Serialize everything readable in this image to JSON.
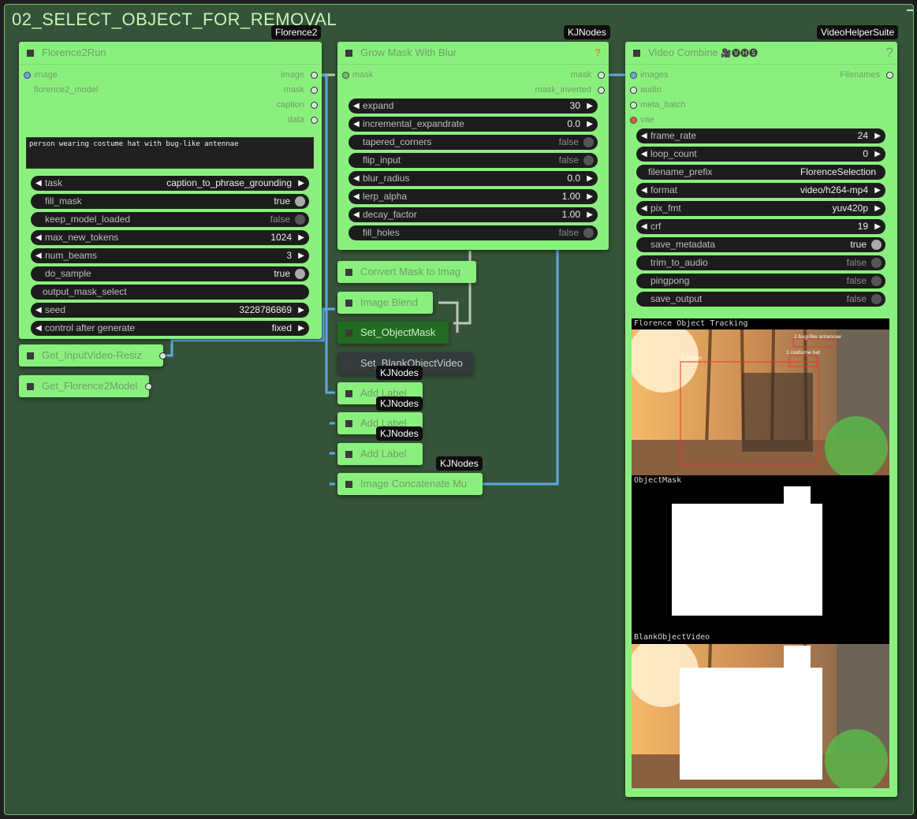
{
  "group": {
    "title": "02_SELECT_OBJECT_FOR_REMOVAL"
  },
  "florence": {
    "badge": "Florence2",
    "title": "Florence2Run",
    "inputs": [
      "image",
      "florence2_model"
    ],
    "outputs": [
      "image",
      "mask",
      "caption",
      "data"
    ],
    "prompt": "person wearing costume hat with bug-like antennae",
    "widgets": [
      {
        "label": "task",
        "value": "caption_to_phrase_grounding",
        "kind": "combo"
      },
      {
        "label": "fill_mask",
        "value": "true",
        "kind": "toggle-on"
      },
      {
        "label": "keep_model_loaded",
        "value": "false",
        "kind": "toggle-off"
      },
      {
        "label": "max_new_tokens",
        "value": "1024",
        "kind": "combo"
      },
      {
        "label": "num_beams",
        "value": "3",
        "kind": "combo"
      },
      {
        "label": "do_sample",
        "value": "true",
        "kind": "toggle-on"
      },
      {
        "label": "output_mask_select",
        "value": "",
        "kind": "text"
      },
      {
        "label": "seed",
        "value": "3228786869",
        "kind": "combo"
      },
      {
        "label": "control after generate",
        "value": "fixed",
        "kind": "combo"
      }
    ]
  },
  "get_input_video": {
    "title": "Get_InputVideo-Resiz"
  },
  "get_florence_model": {
    "title": "Get_Florence2Model"
  },
  "grow_mask": {
    "badge": "KJNodes",
    "title": "Grow Mask With Blur",
    "help": "?",
    "input": "mask",
    "outputs": [
      "mask",
      "mask_inverted"
    ],
    "widgets": [
      {
        "label": "expand",
        "value": "30",
        "kind": "combo"
      },
      {
        "label": "incremental_expandrate",
        "value": "0.0",
        "kind": "combo"
      },
      {
        "label": "tapered_corners",
        "value": "false",
        "kind": "toggle-off"
      },
      {
        "label": "flip_input",
        "value": "false",
        "kind": "toggle-off"
      },
      {
        "label": "blur_radius",
        "value": "0.0",
        "kind": "combo"
      },
      {
        "label": "lerp_alpha",
        "value": "1.00",
        "kind": "combo"
      },
      {
        "label": "decay_factor",
        "value": "1.00",
        "kind": "combo"
      },
      {
        "label": "fill_holes",
        "value": "false",
        "kind": "toggle-off"
      }
    ]
  },
  "mid_nodes": {
    "convert": "Convert Mask to Imag",
    "blend": "Image Blend",
    "set_mask": "Set_ObjectMask",
    "set_blank": "Set_BlankObjectVideo",
    "label1": "Add Label",
    "label2": "Add Label",
    "label3": "Add Label",
    "concat": "Image Concatenate Mu",
    "kj_badges": [
      "KJNodes",
      "KJNodes",
      "KJNodes",
      "KJNodes"
    ]
  },
  "video_combine": {
    "badge": "VideoHelperSuite",
    "title": "Video Combine",
    "title_icons": "🎥🅥🅗🅢",
    "help": "?",
    "inputs": [
      "images",
      "audio",
      "meta_batch",
      "vae"
    ],
    "output": "Filenames",
    "widgets": [
      {
        "label": "frame_rate",
        "value": "24",
        "kind": "combo"
      },
      {
        "label": "loop_count",
        "value": "0",
        "kind": "combo"
      },
      {
        "label": "filename_prefix",
        "value": "FlorenceSelection",
        "kind": "text"
      },
      {
        "label": "format",
        "value": "video/h264-mp4",
        "kind": "combo"
      },
      {
        "label": "pix_fmt",
        "value": "yuv420p",
        "kind": "combo"
      },
      {
        "label": "crf",
        "value": "19",
        "kind": "combo"
      },
      {
        "label": "save_metadata",
        "value": "true",
        "kind": "toggle-on"
      },
      {
        "label": "trim_to_audio",
        "value": "false",
        "kind": "toggle-off"
      },
      {
        "label": "pingpong",
        "value": "false",
        "kind": "toggle-off"
      },
      {
        "label": "save_output",
        "value": "false",
        "kind": "toggle-off"
      }
    ],
    "preview_labels": [
      "Florence Object Tracking",
      "ObjectMask",
      "BlankObjectVideo"
    ],
    "bbox_labels": [
      "0.person",
      "1.costume hat",
      "2.bug-like antennae"
    ]
  },
  "colors": {
    "node": "#8af07d",
    "canvas": "#355338",
    "link_blue": "#5fa8e6",
    "link_gray": "#bfc7bf"
  }
}
